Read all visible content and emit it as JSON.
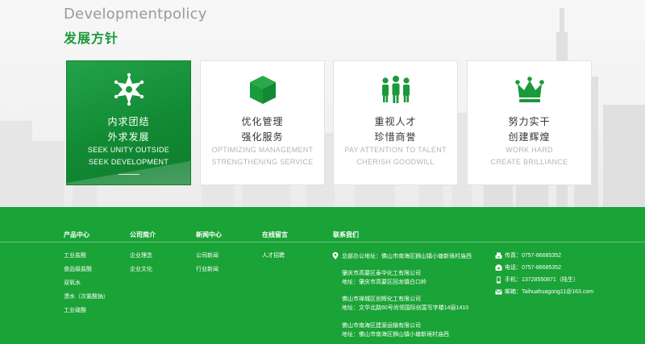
{
  "heading": {
    "en": "Developmentpolicy",
    "cn": "发展方针"
  },
  "cards": [
    {
      "icon": "sheriff-star-icon",
      "cn1": "内求团结",
      "cn2": "外求发展",
      "en1": "SEEK UNITY OUTSIDE",
      "en2": "SEEK DEVELOPMENT",
      "active": true
    },
    {
      "icon": "cube-icon",
      "cn1": "优化管理",
      "cn2": "强化服务",
      "en1": "OPTIMIZING MANAGEMENT",
      "en2": "STRENGTHENING SERVICE",
      "active": false
    },
    {
      "icon": "team-people-icon",
      "cn1": "重视人才",
      "cn2": "珍惜商誉",
      "en1": "PAY ATTENTION TO TALENT",
      "en2": "CHERISH GOODWILL",
      "active": false
    },
    {
      "icon": "crown-icon",
      "cn1": "努力实干",
      "cn2": "创建辉煌",
      "en1": "WORK HARD",
      "en2": "CREATE BRILLIANCE",
      "active": false
    }
  ],
  "footer": {
    "nav": [
      {
        "title": "产品中心",
        "links": [
          "工业盐酸",
          "食品级盐酸",
          "双氧水",
          "漂水（次氯酸钠）",
          "工业硫酸"
        ]
      },
      {
        "title": "公司简介",
        "links": [
          "企业理念",
          "企业文化"
        ]
      },
      {
        "title": "新闻中心",
        "links": [
          "公司新闻",
          "行业新闻"
        ]
      },
      {
        "title": "在线留言",
        "links": [
          "人才招聘"
        ]
      }
    ],
    "contact": {
      "title": "联系我们",
      "blocks": [
        [
          "总部办公地址：佛山市南海区狮山镇小塘新境村庙西"
        ],
        [
          "肇庆市高要区泰华化工有限公司",
          "地址：肇庆市高要区回龙镇白口岭"
        ],
        [
          "佛山市禅城区创辉化工有限公司",
          "地址：文华北路60号尚领国际创富写字楼14层1410"
        ],
        [
          "佛山市南海区建源运输有限公司",
          "地址：佛山市南海区狮山镇小塘新境村庙西"
        ]
      ]
    },
    "side": [
      {
        "icon": "fax-icon",
        "text": "传真：0757-86685352"
      },
      {
        "icon": "phone-icon",
        "text": "电话：0757-86685352"
      },
      {
        "icon": "mobile-icon",
        "text": "手机：13728550871（陆生）"
      },
      {
        "icon": "mail-icon",
        "text": "邮箱：Taihuahuagong11@163.com"
      }
    ]
  }
}
